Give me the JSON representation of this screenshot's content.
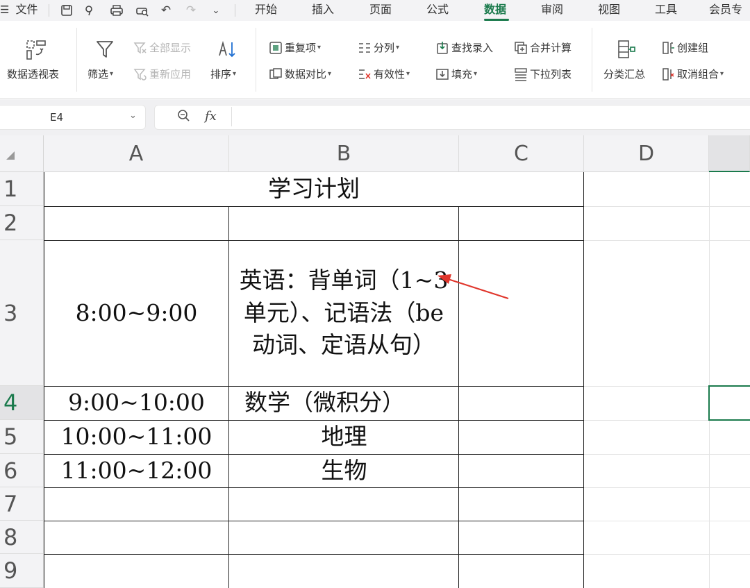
{
  "menubar": {
    "file_label": "文件",
    "tabs": [
      "开始",
      "插入",
      "页面",
      "公式",
      "数据",
      "审阅",
      "视图",
      "工具",
      "会员专"
    ],
    "active_tab": "数据"
  },
  "ribbon": {
    "pivot": "数据透视表",
    "filter": "筛选",
    "show_all": "全部显示",
    "reapply": "重新应用",
    "sort": "排序",
    "duplicates": "重复项",
    "compare": "数据对比",
    "split": "分列",
    "validity": "有效性",
    "lookup_entry": "查找录入",
    "fill": "填充",
    "consolidate": "合并计算",
    "dropdown_list": "下拉列表",
    "subtotal": "分类汇总",
    "create_group": "创建组",
    "ungroup": "取消组合"
  },
  "formula_bar": {
    "cell_ref": "E4",
    "fx": "fx",
    "content": ""
  },
  "sheet": {
    "columns": [
      "A",
      "B",
      "C",
      "D"
    ],
    "rows": [
      "1",
      "2",
      "3",
      "4",
      "5",
      "6",
      "7",
      "8",
      "9"
    ],
    "active_cell": "E4",
    "title": "学习计划",
    "cells": {
      "A3": "8:00~9:00",
      "B3": "英语：背单词（1~3单元）、记语法（be动词、定语从句）",
      "A4": "9:00~10:00",
      "B4": "数学（微积分）",
      "A5": "10:00~11:00",
      "B5": "地理",
      "A6": "11:00~12:00",
      "B6": "生物"
    }
  },
  "colors": {
    "accent": "#1a7a4c",
    "arrow": "#e0352b"
  }
}
